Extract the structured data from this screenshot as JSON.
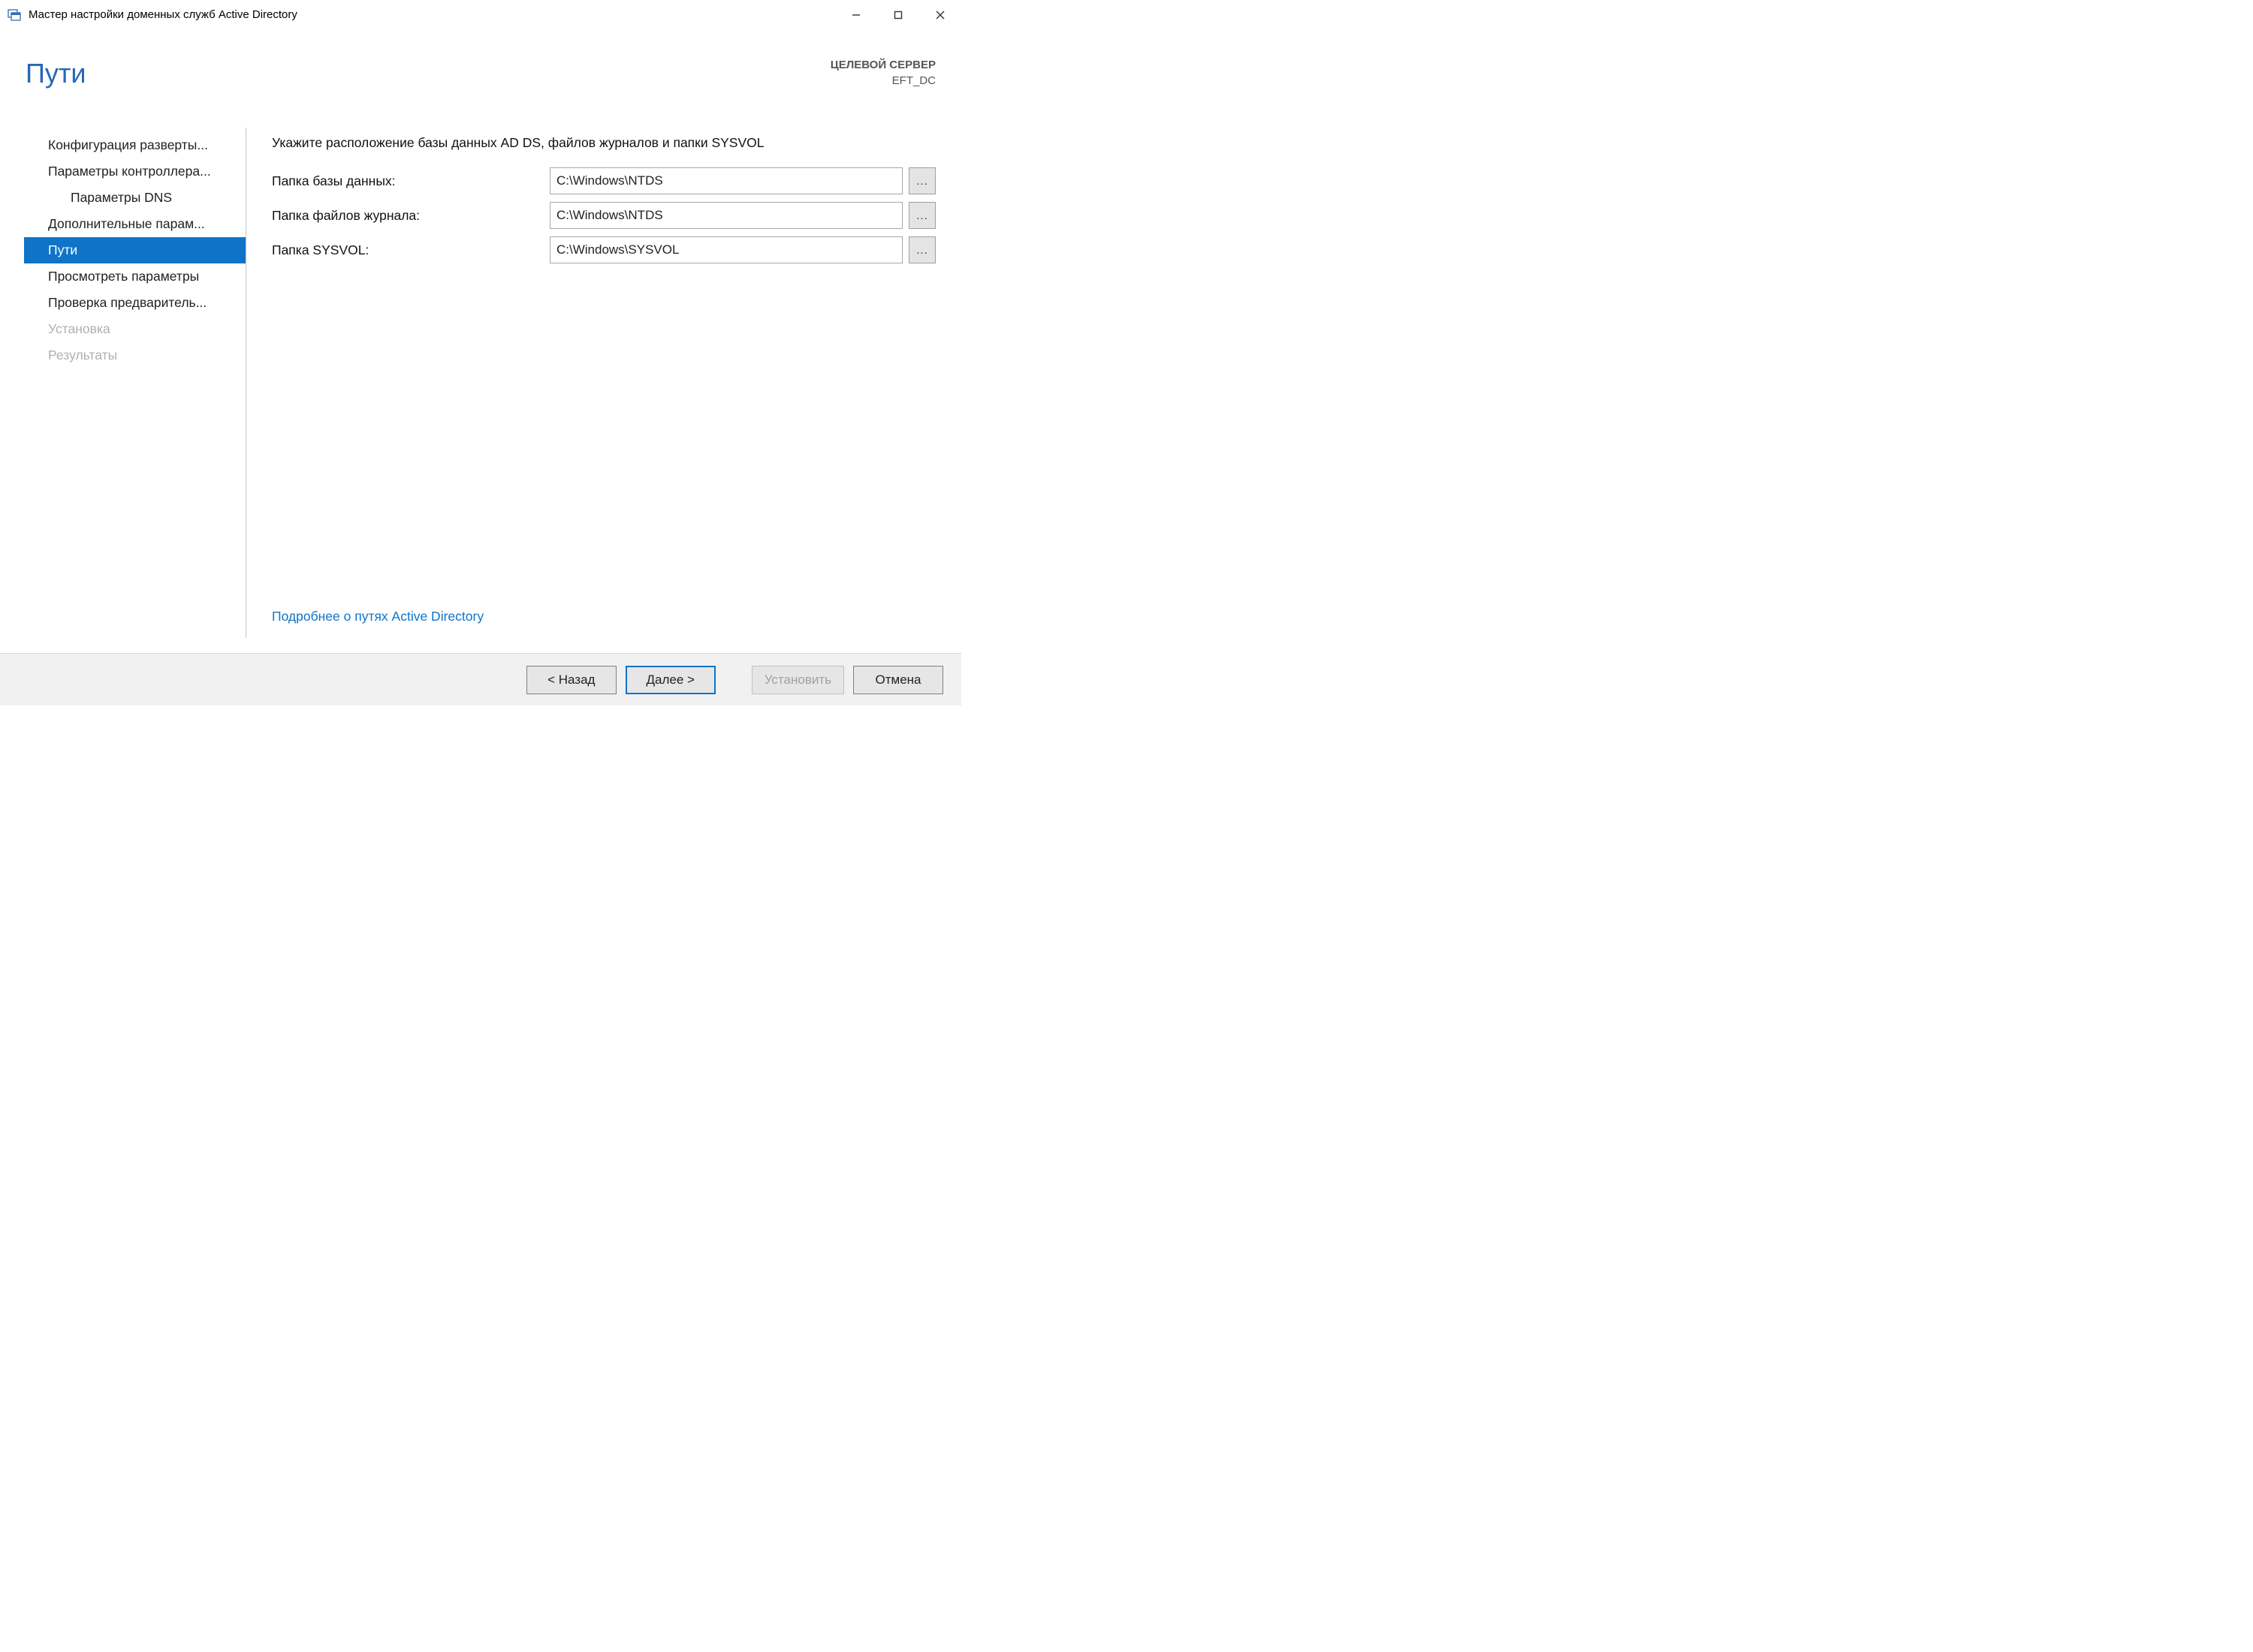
{
  "window": {
    "title": "Мастер настройки доменных служб Active Directory"
  },
  "header": {
    "page_title": "Пути",
    "target_label": "ЦЕЛЕВОЙ СЕРВЕР",
    "target_server": "EFT_DC"
  },
  "sidebar": {
    "items": [
      {
        "label": "Конфигурация разверты...",
        "indent": false,
        "selected": false,
        "disabled": false
      },
      {
        "label": "Параметры контроллера...",
        "indent": false,
        "selected": false,
        "disabled": false
      },
      {
        "label": "Параметры DNS",
        "indent": true,
        "selected": false,
        "disabled": false
      },
      {
        "label": "Дополнительные парам...",
        "indent": false,
        "selected": false,
        "disabled": false
      },
      {
        "label": "Пути",
        "indent": false,
        "selected": true,
        "disabled": false
      },
      {
        "label": "Просмотреть параметры",
        "indent": false,
        "selected": false,
        "disabled": false
      },
      {
        "label": "Проверка предваритель...",
        "indent": false,
        "selected": false,
        "disabled": false
      },
      {
        "label": "Установка",
        "indent": false,
        "selected": false,
        "disabled": true
      },
      {
        "label": "Результаты",
        "indent": false,
        "selected": false,
        "disabled": true
      }
    ]
  },
  "main": {
    "instruction": "Укажите расположение базы данных AD DS, файлов журналов и папки SYSVOL",
    "fields": {
      "database": {
        "label": "Папка базы данных:",
        "value": "C:\\Windows\\NTDS",
        "browse": "..."
      },
      "log": {
        "label": "Папка файлов журнала:",
        "value": "C:\\Windows\\NTDS",
        "browse": "..."
      },
      "sysvol": {
        "label": "Папка SYSVOL:",
        "value": "C:\\Windows\\SYSVOL",
        "browse": "..."
      }
    },
    "help_link": "Подробнее о путях Active Directory"
  },
  "footer": {
    "back": "< Назад",
    "next": "Далее >",
    "install": "Установить",
    "cancel": "Отмена"
  }
}
